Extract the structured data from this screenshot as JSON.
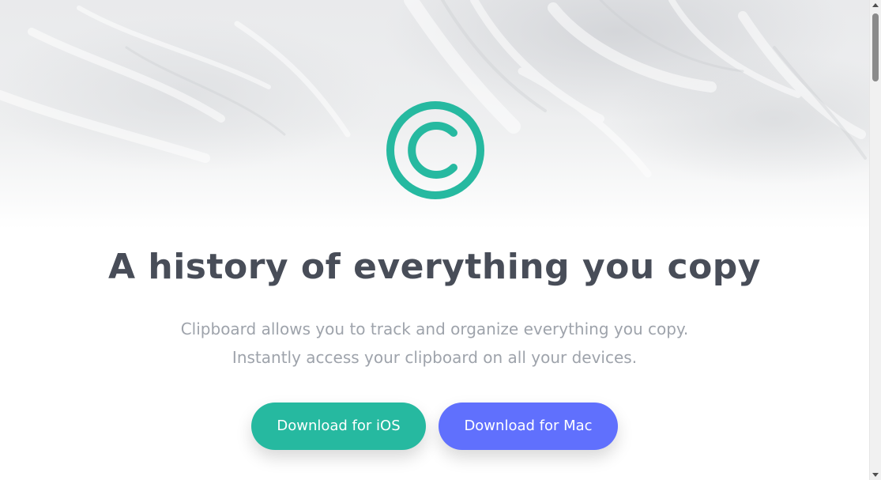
{
  "hero": {
    "logo_icon": "copyright-logo-icon",
    "title": "A history of everything you copy",
    "subtitle_lines": [
      "Clipboard allows you to track and organize everything you copy.",
      "Instantly access your clipboard on all your devices."
    ]
  },
  "buttons": {
    "ios_label": "Download for iOS",
    "mac_label": "Download for Mac"
  },
  "colors": {
    "accent_teal": "#26b9a0",
    "accent_blue": "#6070fd",
    "title_text": "#484d58",
    "subtitle_text": "#9ea3ab"
  }
}
